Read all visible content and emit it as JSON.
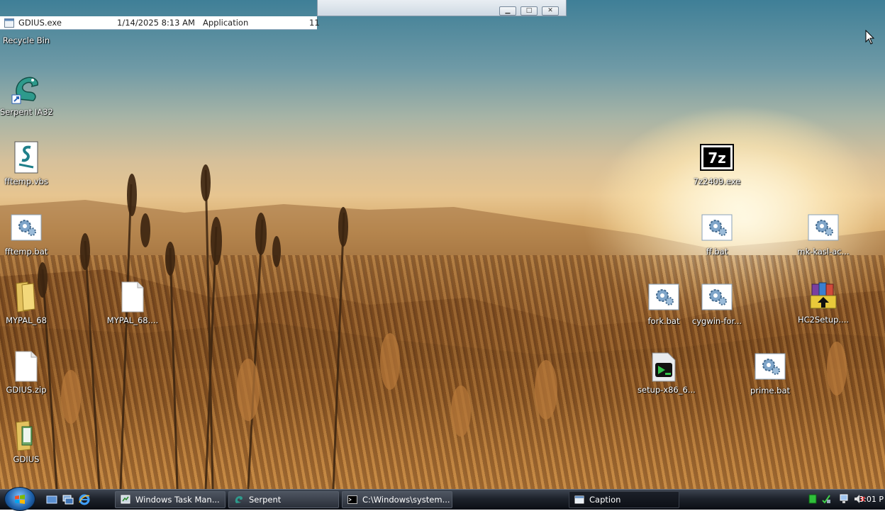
{
  "window_fragment": {
    "row": {
      "name": "GDIUS.exe",
      "date": "1/14/2025 8:13 AM",
      "type": "Application",
      "size": "11"
    }
  },
  "desktop_icons": {
    "recycle_bin": "Recycle Bin",
    "serpent_ia32": "Serpent IA32",
    "fftemp_vbs": "fftemp.vbs",
    "fftemp_bat": "fftemp.bat",
    "mypal_folder": "MYPAL_68",
    "mypal_file": "MYPAL_68....",
    "gdius_zip": "GDIUS.zip",
    "gdius_folder": "GDIUS",
    "sevenzip": "7z2409.exe",
    "ff_bat": "ff.bat",
    "mk_kasl": "mk-kasl-ac...",
    "fork_bat": "fork.bat",
    "cygwin": "cygwin-for...",
    "hc2setup": "HC2Setup....",
    "setup_x86": "setup-x86_6...",
    "prime_bat": "prime.bat"
  },
  "taskbar": {
    "buttons": [
      {
        "label": "Windows Task Man..."
      },
      {
        "label": "Serpent"
      },
      {
        "label": "C:\\Windows\\system..."
      },
      {
        "label": "Caption"
      }
    ],
    "clock": "3:01 P"
  },
  "colors": {
    "taskbar": "#1d222b",
    "icon_label": "#ffffff"
  }
}
